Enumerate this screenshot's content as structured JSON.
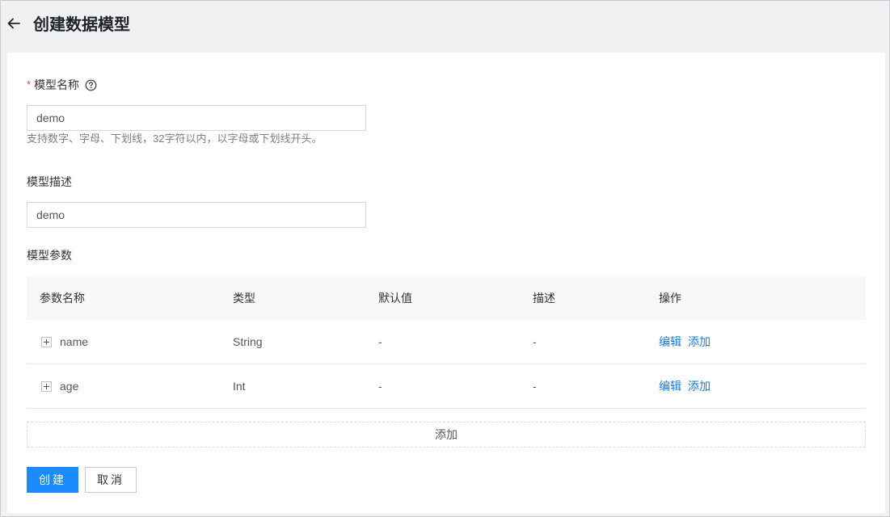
{
  "header": {
    "back_icon": "arrow-left-icon",
    "title": "创建数据模型"
  },
  "form": {
    "name": {
      "label": "模型名称",
      "required_mark": "*",
      "help_icon": "question-circle-icon",
      "value": "demo",
      "hint": "支持数字、字母、下划线，32字符以内，以字母或下划线开头。"
    },
    "description": {
      "label": "模型描述",
      "value": "demo"
    },
    "params": {
      "label": "模型参数",
      "columns": [
        "参数名称",
        "类型",
        "默认值",
        "描述",
        "操作"
      ],
      "rows": [
        {
          "name": "name",
          "type": "String",
          "default": "-",
          "desc": "-",
          "edit": "编辑",
          "add": "添加"
        },
        {
          "name": "age",
          "type": "Int",
          "default": "-",
          "desc": "-",
          "edit": "编辑",
          "add": "添加"
        }
      ],
      "add_row_label": "添加"
    }
  },
  "actions": {
    "create": "创建",
    "cancel": "取消"
  },
  "colors": {
    "primary": "#1a8cff",
    "link": "#1a7bd4",
    "required": "#e5484d"
  }
}
